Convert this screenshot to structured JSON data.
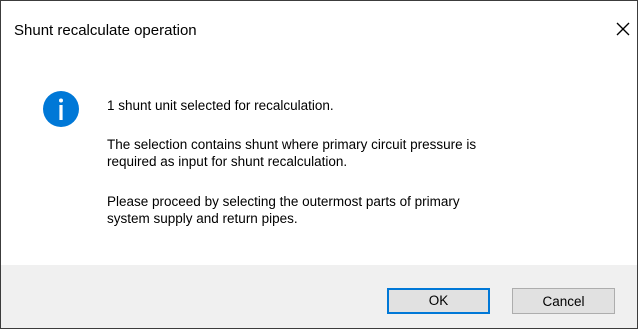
{
  "dialog": {
    "title": "Shunt recalculate operation",
    "icon": "info-icon",
    "messages": [
      "1 shunt unit selected for recalculation.",
      "The selection contains shunt where primary circuit pressure is",
      "required as input for shunt recalculation.",
      "Please proceed by selecting the outermost parts of primary",
      "system supply and return pipes."
    ],
    "buttons": {
      "ok": "OK",
      "cancel": "Cancel"
    }
  },
  "colors": {
    "info_icon": "#0078d7",
    "footer_bg": "#f0f0f0",
    "default_button_border": "#0078d7"
  }
}
